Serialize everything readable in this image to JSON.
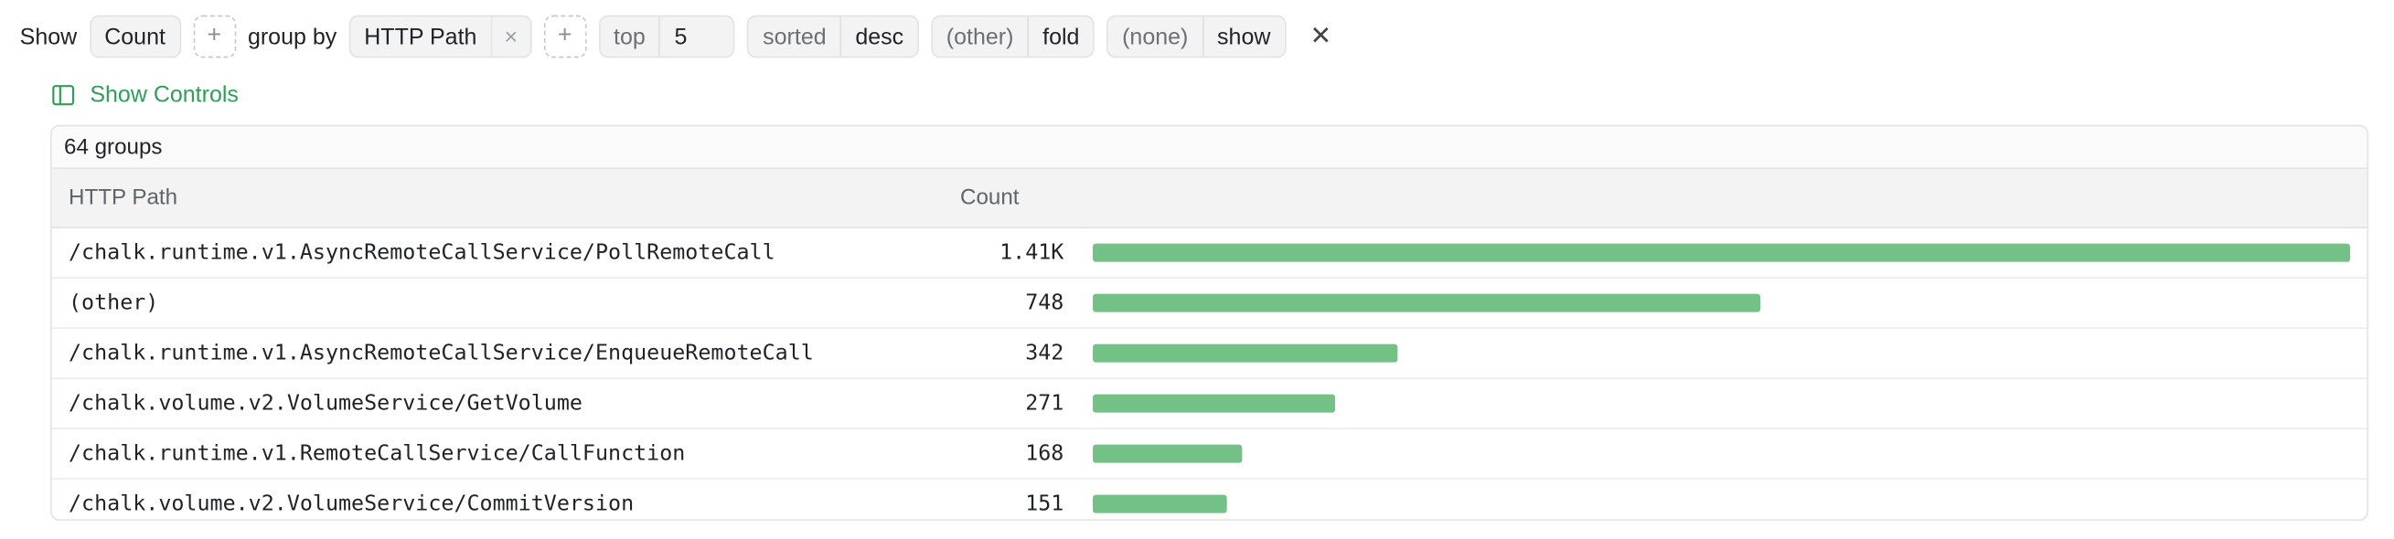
{
  "query": {
    "show_label": "Show",
    "metric": "Count",
    "group_by_label": "group by",
    "group_field": "HTTP Path",
    "top_label": "top",
    "top_value": "5",
    "sorted_label": "sorted",
    "sorted_value": "desc",
    "other_label": "(other)",
    "other_value": "fold",
    "none_label": "(none)",
    "none_value": "show"
  },
  "controls": {
    "label": "Show Controls"
  },
  "panel": {
    "groups_label": "64 groups",
    "columns": [
      "HTTP Path",
      "Count"
    ],
    "rows": [
      {
        "path": "/chalk.runtime.v1.AsyncRemoteCallService/PollRemoteCall",
        "count_label": "1.41K",
        "count": 1410
      },
      {
        "path": "(other)",
        "count_label": "748",
        "count": 748
      },
      {
        "path": "/chalk.runtime.v1.AsyncRemoteCallService/EnqueueRemoteCall",
        "count_label": "342",
        "count": 342
      },
      {
        "path": "/chalk.volume.v2.VolumeService/GetVolume",
        "count_label": "271",
        "count": 271
      },
      {
        "path": "/chalk.runtime.v1.RemoteCallService/CallFunction",
        "count_label": "168",
        "count": 168
      },
      {
        "path": "/chalk.volume.v2.VolumeService/CommitVersion",
        "count_label": "151",
        "count": 151
      }
    ]
  },
  "colors": {
    "accent": "#2f9e57",
    "bar": "#74c187"
  },
  "icons": {
    "add": "plus-icon",
    "remove": "close-icon",
    "clear": "close-icon",
    "controls": "sidebar-panel-icon"
  }
}
